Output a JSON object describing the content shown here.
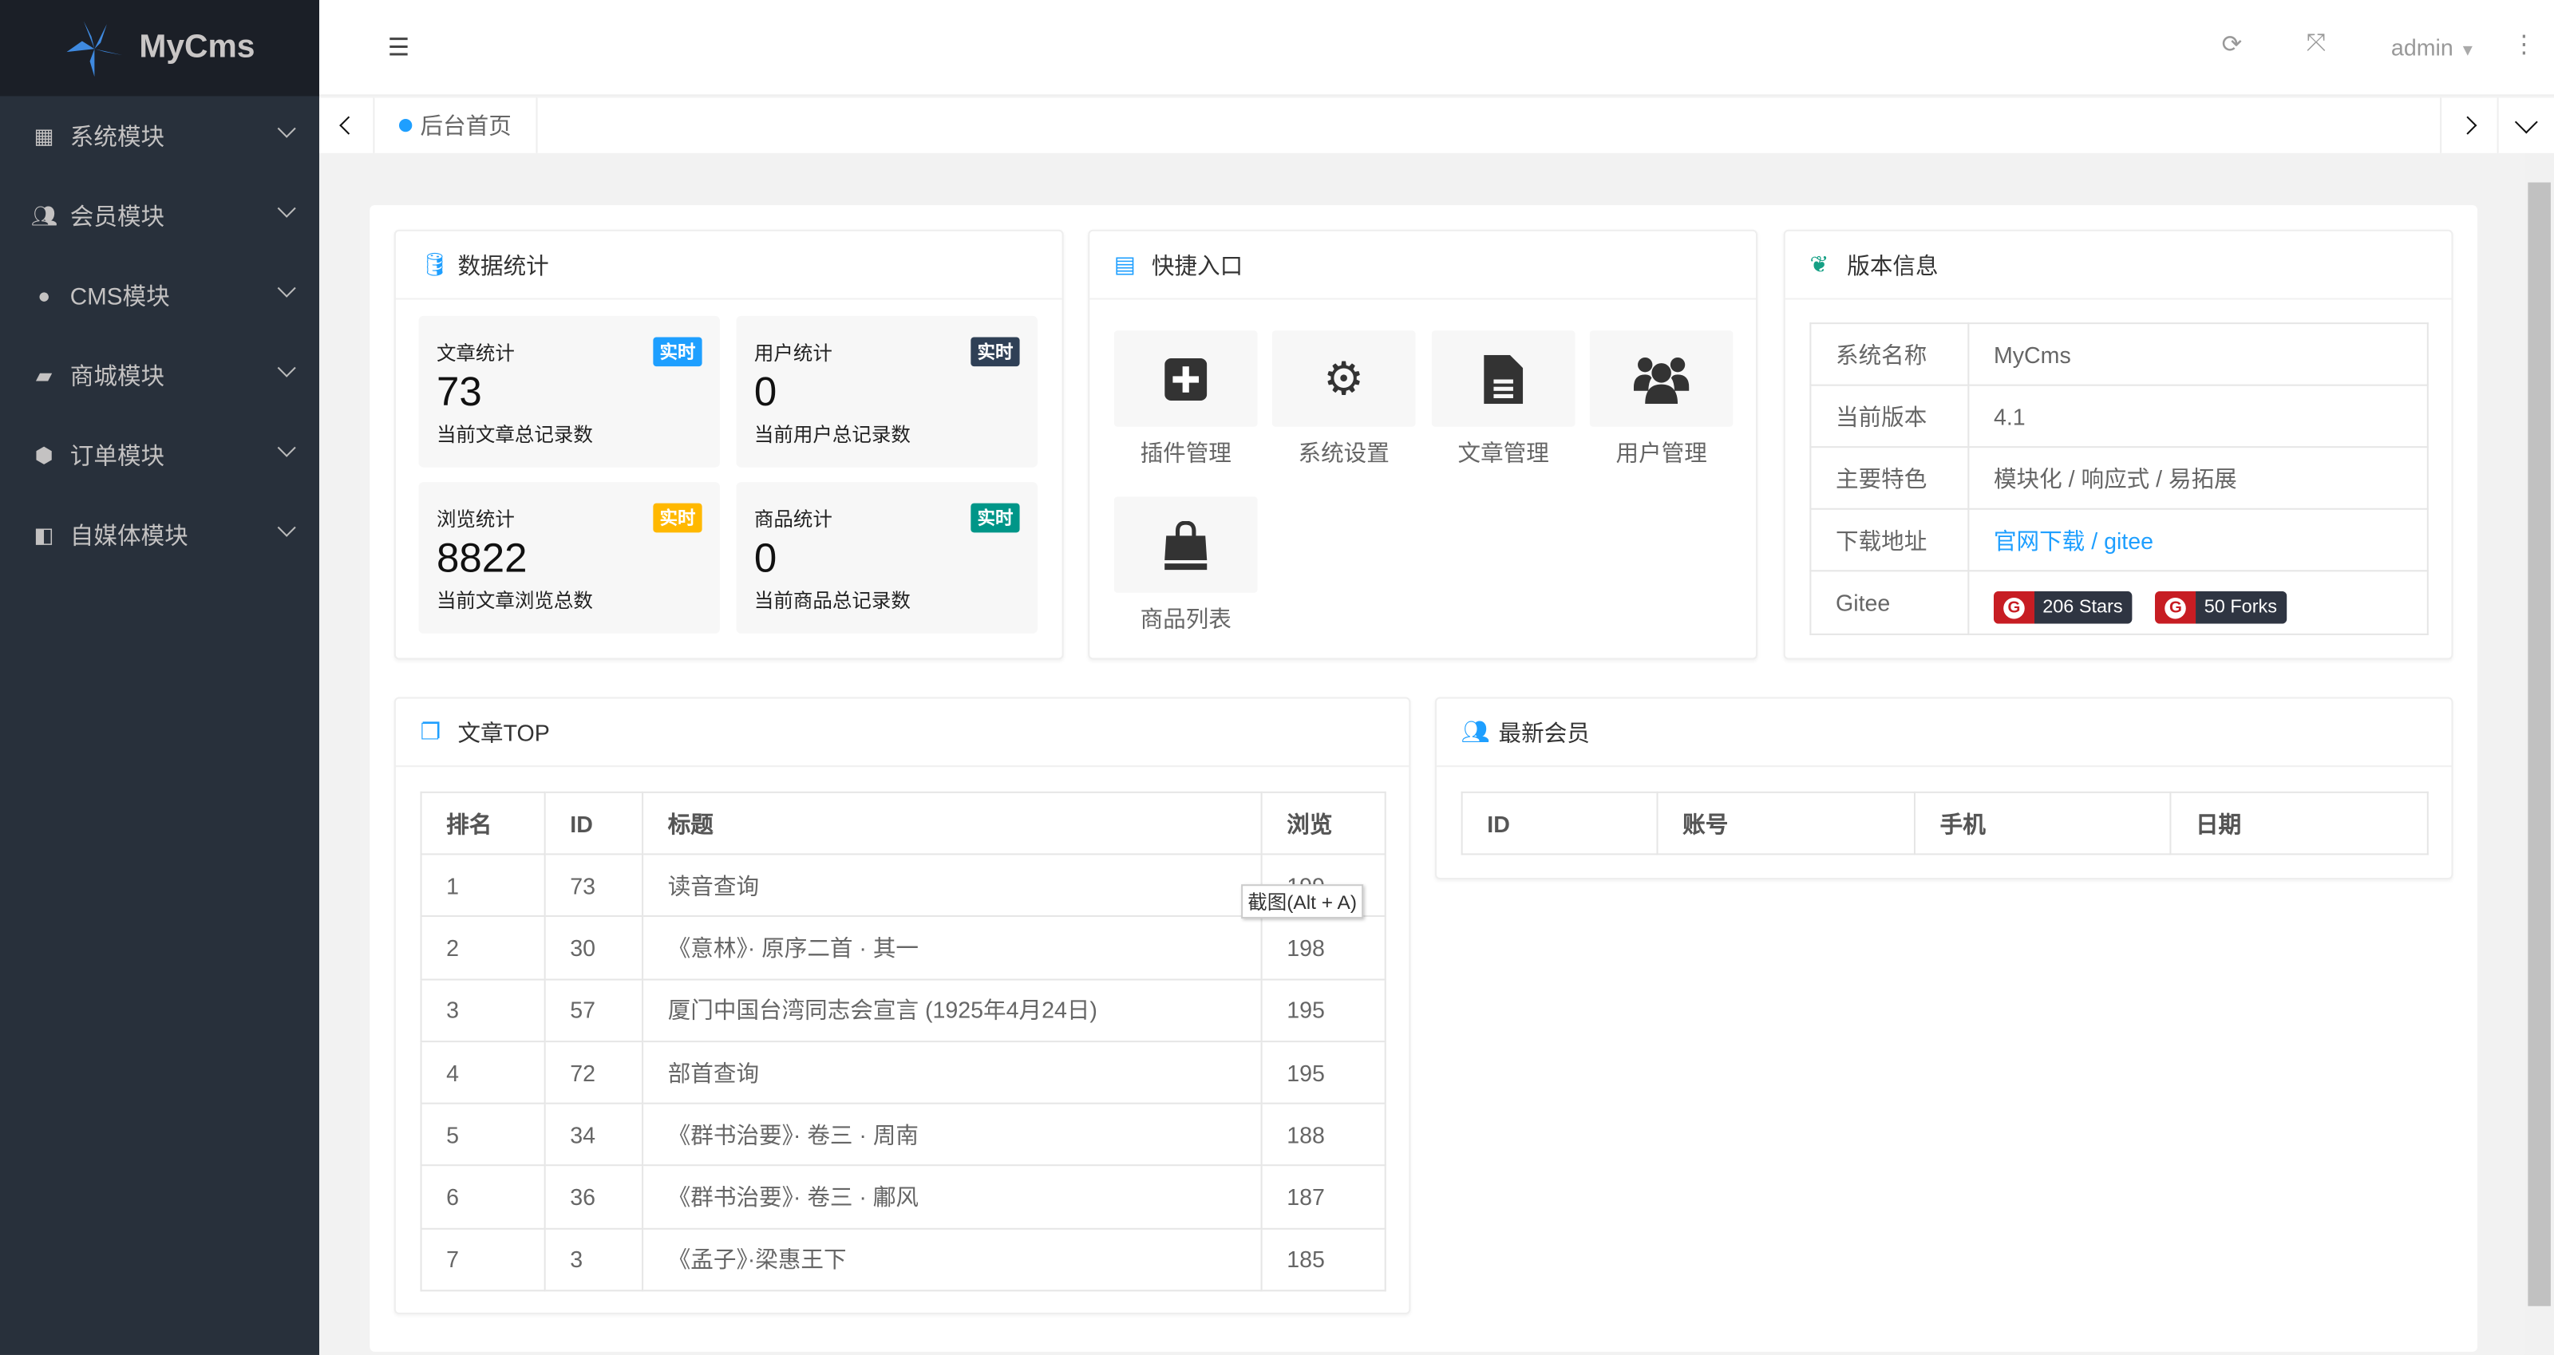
{
  "app": {
    "name": "MyCms"
  },
  "colors": {
    "sidebar": "#28303b",
    "logo_bg": "#1b1f27",
    "accent": "#1e9fff",
    "badge_blue": "#1e9fff",
    "badge_dark": "#2f4056",
    "badge_orange": "#ffb800",
    "badge_green": "#009688",
    "gitee_red": "#c71d23"
  },
  "sidebar": {
    "items": [
      {
        "label": "系统模块",
        "icon": "windows-icon"
      },
      {
        "label": "会员模块",
        "icon": "users-icon"
      },
      {
        "label": "CMS模块",
        "icon": "compass-icon"
      },
      {
        "label": "商城模块",
        "icon": "shopping-bag-icon"
      },
      {
        "label": "订单模块",
        "icon": "cube-icon"
      },
      {
        "label": "自媒体模块",
        "icon": "video-icon"
      }
    ]
  },
  "header": {
    "user": "admin"
  },
  "tabs": [
    {
      "label": "后台首页"
    }
  ],
  "stats": {
    "title": "数据统计",
    "items": [
      {
        "label": "文章统计",
        "value": "73",
        "desc": "当前文章总记录数",
        "badge": "实时"
      },
      {
        "label": "用户统计",
        "value": "0",
        "desc": "当前用户总记录数",
        "badge": "实时"
      },
      {
        "label": "浏览统计",
        "value": "8822",
        "desc": "当前文章浏览总数",
        "badge": "实时"
      },
      {
        "label": "商品统计",
        "value": "0",
        "desc": "当前商品总记录数",
        "badge": "实时"
      }
    ]
  },
  "quick": {
    "title": "快捷入口",
    "items": [
      {
        "label": "插件管理",
        "icon": "plus-square-icon"
      },
      {
        "label": "系统设置",
        "icon": "gears-icon"
      },
      {
        "label": "文章管理",
        "icon": "file-text-icon"
      },
      {
        "label": "用户管理",
        "icon": "users-icon"
      },
      {
        "label": "商品列表",
        "icon": "shopping-bag-icon"
      }
    ]
  },
  "version": {
    "title": "版本信息",
    "rows": [
      {
        "k": "系统名称",
        "v": "MyCms"
      },
      {
        "k": "当前版本",
        "v": "4.1"
      },
      {
        "k": "主要特色",
        "v": "模块化 / 响应式 / 易拓展"
      },
      {
        "k": "下载地址",
        "link1": "官网下载",
        "sep": " / ",
        "link2": "gitee"
      },
      {
        "k": "Gitee",
        "stars": "206 Stars",
        "forks": "50 Forks"
      }
    ]
  },
  "articles": {
    "title": "文章TOP",
    "columns": [
      "排名",
      "ID",
      "标题",
      "浏览"
    ],
    "rows": [
      [
        "1",
        "73",
        "读音查询",
        "199"
      ],
      [
        "2",
        "30",
        "《意林》· 原序二首 · 其一",
        "198"
      ],
      [
        "3",
        "57",
        "厦门中国台湾同志会宣言 (1925年4月24日)",
        "195"
      ],
      [
        "4",
        "72",
        "部首查询",
        "195"
      ],
      [
        "5",
        "34",
        "《群书治要》· 卷三 · 周南",
        "188"
      ],
      [
        "6",
        "36",
        "《群书治要》· 卷三 · 鄘风",
        "187"
      ],
      [
        "7",
        "3",
        "《孟子》·梁惠王下",
        "185"
      ]
    ]
  },
  "members": {
    "title": "最新会员",
    "columns": [
      "ID",
      "账号",
      "手机",
      "日期"
    ]
  },
  "tooltip": "截图(Alt + A)"
}
